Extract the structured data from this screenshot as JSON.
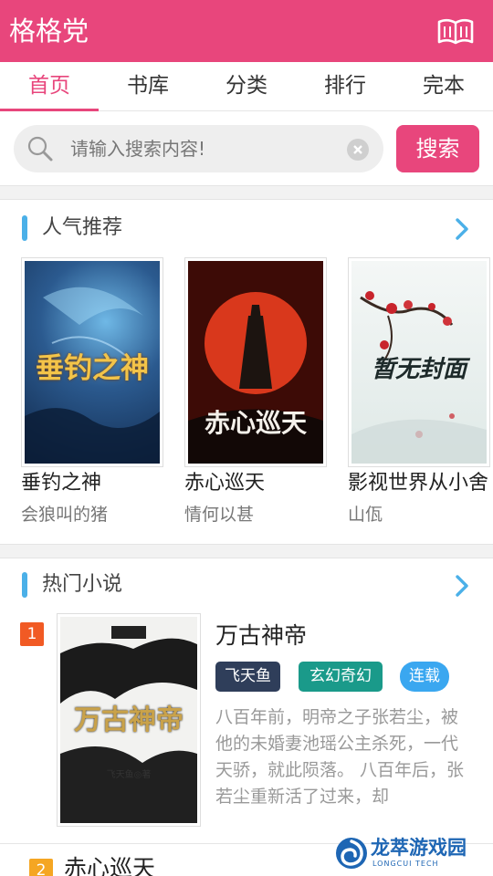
{
  "header": {
    "title": "格格党",
    "icon": "book-open-icon"
  },
  "tabs": [
    {
      "label": "首页",
      "active": true
    },
    {
      "label": "书库",
      "active": false
    },
    {
      "label": "分类",
      "active": false
    },
    {
      "label": "排行",
      "active": false
    },
    {
      "label": "完本",
      "active": false
    }
  ],
  "search": {
    "placeholder": "请输入搜索内容!",
    "value": "",
    "button_label": "搜索"
  },
  "recommend": {
    "title": "人气推荐",
    "books": [
      {
        "title": "垂钓之神",
        "author": "会狼叫的猪",
        "cover_text": "垂钓之神"
      },
      {
        "title": "赤心巡天",
        "author": "情何以甚",
        "cover_text": "赤心巡天"
      },
      {
        "title": "影视世界从小舍",
        "author": "山佤",
        "cover_text": "暂无封面"
      }
    ]
  },
  "hot": {
    "title": "热门小说",
    "items": [
      {
        "rank": "1",
        "title": "万古神帝",
        "cover_text": "万古神帝",
        "cover_author": "飞天鱼◎著",
        "tags": [
          {
            "label": "飞天鱼",
            "color": "#2f3e5a"
          },
          {
            "label": "玄幻奇幻",
            "color": "#1a9a8a"
          },
          {
            "label": "连载",
            "color": "#3aa7f0"
          }
        ],
        "description": "八百年前，明帝之子张若尘，被他的未婚妻池瑶公主杀死，一代天骄，就此陨落。 八百年后，张若尘重新活了过来，却"
      },
      {
        "rank": "2",
        "title": "赤心巡天"
      }
    ]
  },
  "watermark": {
    "name": "龙萃游戏园",
    "sub": "LONGCUI TECH"
  },
  "colors": {
    "brand": "#e8467c",
    "accent_blue": "#4bb0e8",
    "rank1": "#f15a24",
    "rank2": "#f5a623"
  }
}
